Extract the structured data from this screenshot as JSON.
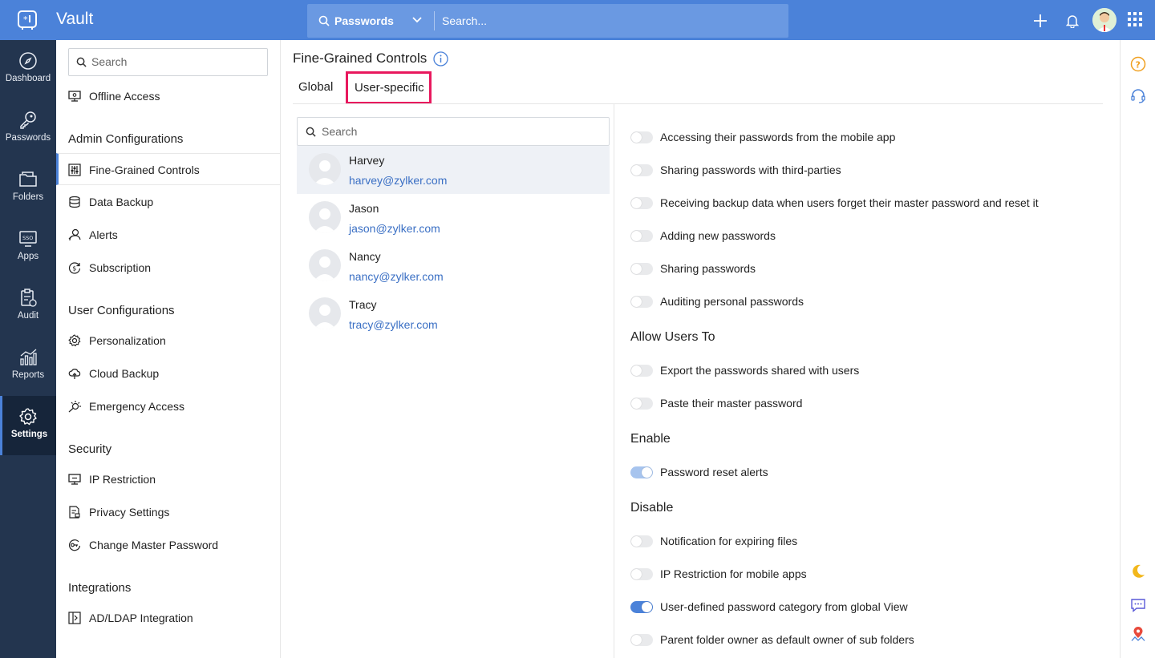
{
  "topbar": {
    "app_title": "Vault",
    "search_scope": "Passwords",
    "search_placeholder": "Search...",
    "icons": [
      "vault-logo-icon",
      "search-icon",
      "chevron-down-icon",
      "plus-icon",
      "bell-icon",
      "user-avatar",
      "apps-grid-icon"
    ]
  },
  "leftnav": {
    "items": [
      {
        "label": "Dashboard",
        "icon": "compass-icon"
      },
      {
        "label": "Passwords",
        "icon": "key-icon"
      },
      {
        "label": "Folders",
        "icon": "folder-icon"
      },
      {
        "label": "Apps",
        "icon": "sso-icon"
      },
      {
        "label": "Audit",
        "icon": "clipboard-icon"
      },
      {
        "label": "Reports",
        "icon": "bar-chart-icon"
      },
      {
        "label": "Settings",
        "icon": "gear-icon",
        "active": true
      }
    ]
  },
  "sidebar": {
    "search_placeholder": "Search",
    "offline_access": "Offline Access",
    "admin_heading": "Admin Configurations",
    "admin_items": [
      "Fine-Grained Controls",
      "Data Backup",
      "Alerts",
      "Subscription"
    ],
    "user_heading": "User Configurations",
    "user_items": [
      "Personalization",
      "Cloud Backup",
      "Emergency Access"
    ],
    "security_heading": "Security",
    "security_items": [
      "IP Restriction",
      "Privacy Settings",
      "Change Master Password"
    ],
    "integrations_heading": "Integrations",
    "integration_items": [
      "AD/LDAP Integration"
    ]
  },
  "main": {
    "title": "Fine-Grained Controls",
    "tabs": [
      "Global",
      "User-specific"
    ],
    "active_tab": "User-specific",
    "user_search_placeholder": "Search",
    "users": [
      {
        "name": "Harvey",
        "email": "harvey@zylker.com",
        "selected": true
      },
      {
        "name": "Jason",
        "email": "jason@zylker.com"
      },
      {
        "name": "Nancy",
        "email": "nancy@zylker.com"
      },
      {
        "name": "Tracy",
        "email": "tracy@zylker.com"
      }
    ],
    "restrict_options": [
      {
        "label": "Accessing their passwords from the mobile app",
        "on": false
      },
      {
        "label": "Sharing passwords with third-parties",
        "on": false
      },
      {
        "label": "Receiving backup data when users forget their master password and reset it",
        "on": false
      },
      {
        "label": "Adding new passwords",
        "on": false
      },
      {
        "label": "Sharing passwords",
        "on": false
      },
      {
        "label": "Auditing personal passwords",
        "on": false
      }
    ],
    "allow_heading": "Allow Users To",
    "allow_options": [
      {
        "label": "Export the passwords shared with users",
        "on": false
      },
      {
        "label": "Paste their master password",
        "on": false
      }
    ],
    "enable_heading": "Enable",
    "enable_options": [
      {
        "label": "Password reset alerts",
        "on": true,
        "state": "partial"
      }
    ],
    "disable_heading": "Disable",
    "disable_options": [
      {
        "label": "Notification for expiring files",
        "on": false
      },
      {
        "label": "IP Restriction for mobile apps",
        "on": false
      },
      {
        "label": "User-defined password category from global View",
        "on": true
      },
      {
        "label": "Parent folder owner as default owner of sub folders",
        "on": false
      }
    ]
  },
  "rightrail": {
    "icons": [
      "help-icon",
      "headset-icon",
      "moon-icon",
      "chat-icon",
      "location-pin-icon"
    ]
  },
  "colors": {
    "topbar": "#4b82d9",
    "leftnav": "#23354f",
    "link": "#3a6fc4",
    "highlight_border": "#e8185d",
    "toggle_on": "#4b82d9"
  }
}
